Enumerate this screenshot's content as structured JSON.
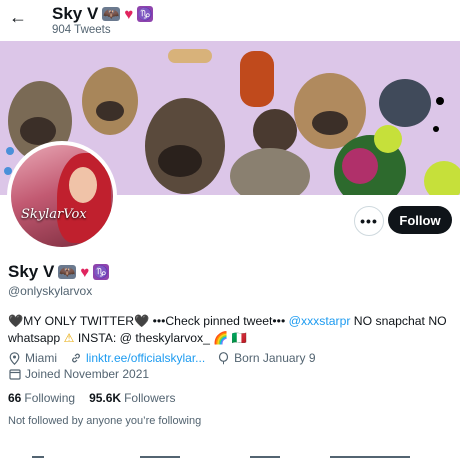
{
  "header": {
    "back_label": "←",
    "name": "Sky V",
    "tweet_count": "904 Tweets"
  },
  "emoji": {
    "bat": "🦇",
    "heart": "♥",
    "zodiac": "♑"
  },
  "avatar": {
    "signature": "SkylarVox"
  },
  "actions": {
    "more_label": "•••",
    "follow_label": "Follow"
  },
  "profile": {
    "name": "Sky V",
    "handle": "@onlyskylarvox",
    "bio_part1": "🖤MY ONLY TWITTER🖤 •••Check pinned tweet••• ",
    "bio_mention": "@xxxstarpr",
    "bio_part2": " NO snapchat NO whatsapp ",
    "bio_warn": "⚠",
    "bio_part3": " INSTA: @ theskylarvox_ 🌈 🇮🇹",
    "location": "Miami",
    "link": "linktr.ee/officialskylar...",
    "birthday": "Born January 9",
    "joined": "Joined November 2021",
    "following_count": "66",
    "following_label": "Following",
    "followers_count": "95.6K",
    "followers_label": "Followers",
    "not_followed": "Not followed by anyone you’re following"
  },
  "colors": {
    "accent": "#1d9bf0",
    "follow_bg": "#0f1419",
    "banner_bg": "#d9c3e4"
  }
}
